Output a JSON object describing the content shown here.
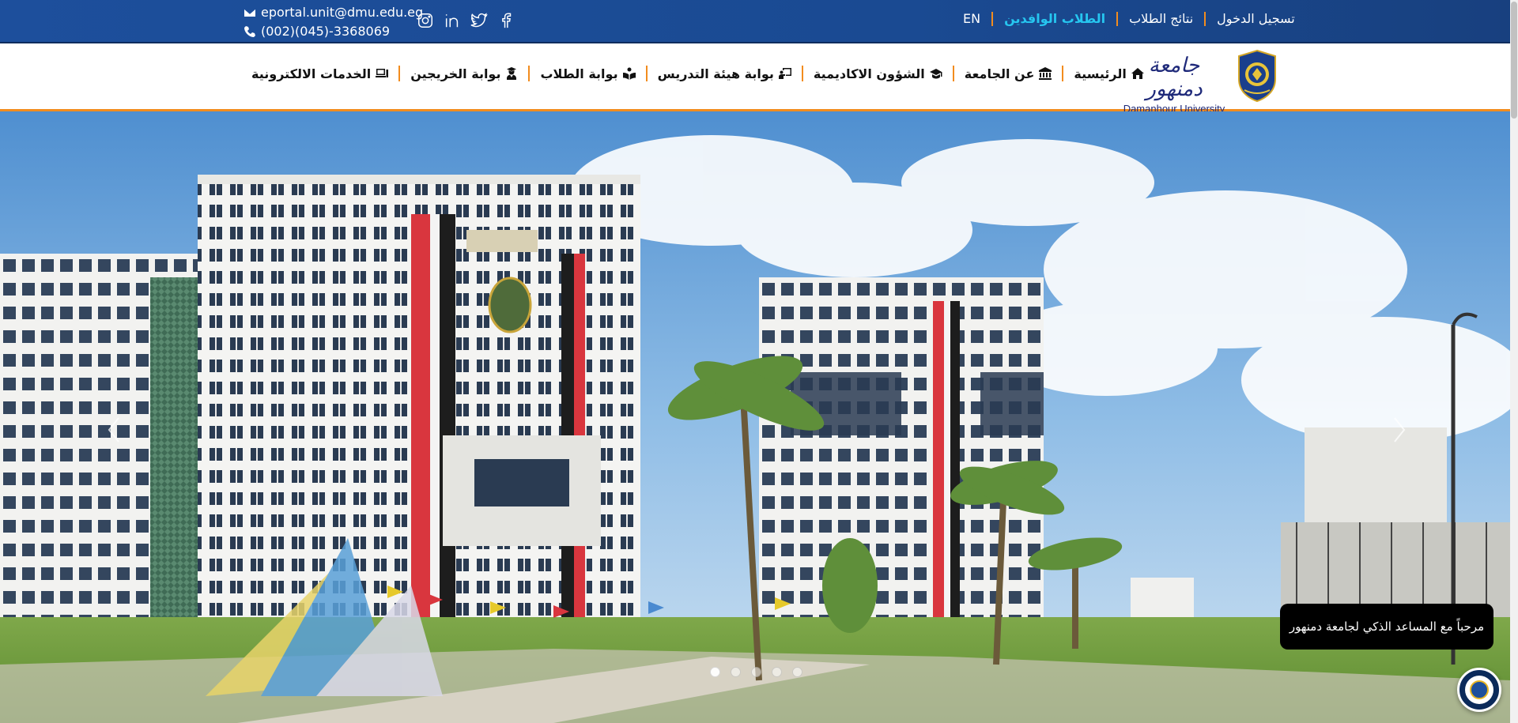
{
  "topbar": {
    "email": "eportal.unit@dmu.edu.eg",
    "phone": "(002)(045)-3368069",
    "social_icons": [
      "instagram-icon",
      "linkedin-icon",
      "twitter-icon",
      "facebook-icon"
    ],
    "links": {
      "lang": "EN",
      "incoming_students": "الطلاب الوافدين",
      "student_results": "نتائج الطلاب",
      "login": "تسجيل الدخول"
    },
    "background_color": "#1d4f9c",
    "highlight_color": "#26c6f0",
    "separator_color": "#f28c1e"
  },
  "logo": {
    "arabic_name": "جامعة دمنهور",
    "english_name": "Damanhour University"
  },
  "nav": {
    "items": [
      {
        "label": "الرئيسية",
        "icon": "home-icon"
      },
      {
        "label": "عن الجامعة",
        "icon": "university-icon"
      },
      {
        "label": "الشؤون الاكاديمية",
        "icon": "graduation-cap-icon"
      },
      {
        "label": "بوابة هيئة التدريس",
        "icon": "chalkboard-teacher-icon"
      },
      {
        "label": "بوابة الطلاب",
        "icon": "book-reader-icon"
      },
      {
        "label": "بوابة الخريجين",
        "icon": "user-graduate-icon"
      },
      {
        "label": "الخدمات الالكترونية",
        "icon": "laptop-icon"
      }
    ]
  },
  "hero": {
    "slide_count": 5,
    "active_slide": 0,
    "prev_icon": "chevron-left-icon",
    "next_icon": "chevron-right-icon"
  },
  "chatbot": {
    "greeting": "مرحباً مع المساعد الذكي لجامعة دمنهور"
  }
}
